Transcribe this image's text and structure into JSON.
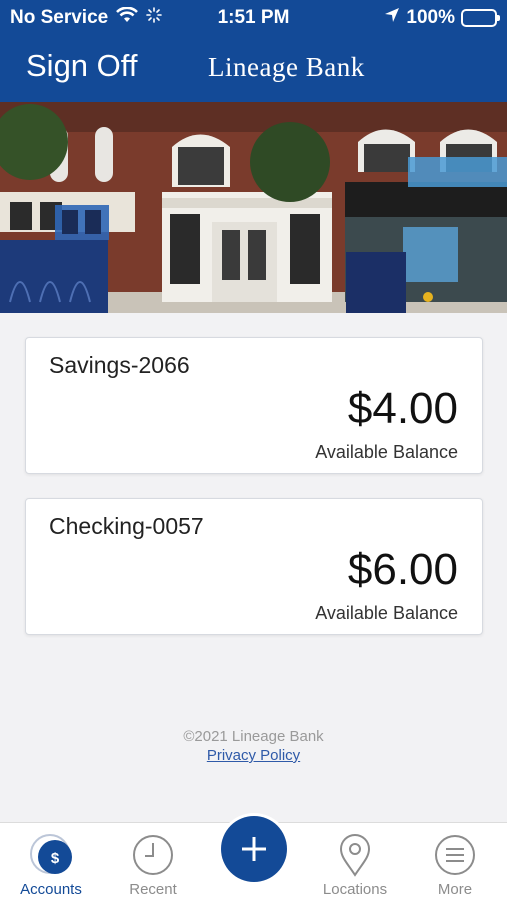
{
  "status_bar": {
    "carrier": "No Service",
    "time": "1:51 PM",
    "battery": "100%"
  },
  "header": {
    "signoff_label": "Sign Off",
    "brand": "Lineage Bank"
  },
  "accounts": [
    {
      "name": "Savings-2066",
      "balance": "$4.00",
      "balance_label": "Available Balance"
    },
    {
      "name": "Checking-0057",
      "balance": "$6.00",
      "balance_label": "Available Balance"
    }
  ],
  "footer": {
    "copyright": "©2021 Lineage Bank",
    "privacy_link": "Privacy Policy"
  },
  "tabbar": {
    "items": [
      {
        "label": "Accounts",
        "icon": "dollar-circle-icon",
        "active": true
      },
      {
        "label": "Recent",
        "icon": "clock-icon",
        "active": false
      },
      {
        "label": "",
        "icon": "plus-icon",
        "active": false
      },
      {
        "label": "Locations",
        "icon": "map-pin-icon",
        "active": false
      },
      {
        "label": "More",
        "icon": "menu-icon",
        "active": false
      }
    ]
  },
  "colors": {
    "brand_blue": "#134a97",
    "background": "#f2f2f4",
    "link": "#2f5aa8",
    "battery_green": "#54d35f"
  }
}
